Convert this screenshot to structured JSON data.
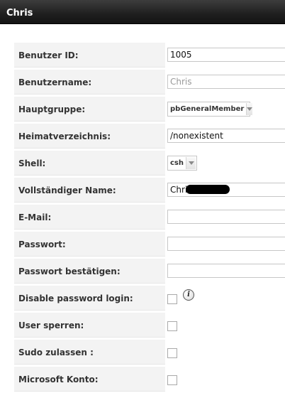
{
  "window": {
    "title": "Chris"
  },
  "form": {
    "user_id": {
      "label": "Benutzer ID:",
      "value": "1005"
    },
    "username": {
      "label": "Benutzername:",
      "value": "Chris"
    },
    "primary_group": {
      "label": "Hauptgruppe:",
      "selected": "pbGeneralMember"
    },
    "home_dir": {
      "label": "Heimatverzeichnis:",
      "value": "/nonexistent"
    },
    "shell": {
      "label": "Shell:",
      "selected": "csh"
    },
    "full_name": {
      "label": "Vollständiger Name:",
      "value": "Chris"
    },
    "email": {
      "label": "E-Mail:",
      "value": ""
    },
    "password": {
      "label": "Passwort:",
      "value": ""
    },
    "password_confirm": {
      "label": "Passwort bestätigen:",
      "value": ""
    },
    "disable_password_login": {
      "label": "Disable password login:",
      "checked": false,
      "info_icon": "info-icon"
    },
    "lock_user": {
      "label": "User sperren:",
      "checked": false
    },
    "sudo": {
      "label": "Sudo zulassen :",
      "checked": false
    },
    "microsoft_account": {
      "label": "Microsoft Konto:",
      "checked": false
    }
  }
}
